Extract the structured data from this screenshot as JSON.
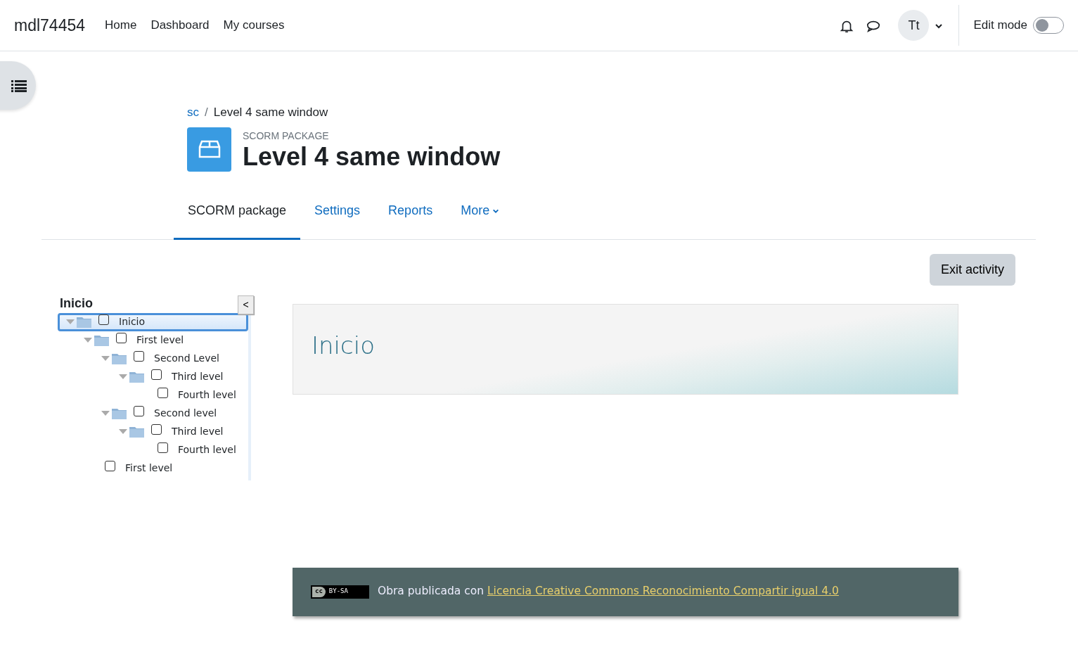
{
  "site_name": "mdl74454",
  "nav_links": [
    {
      "label": "Home"
    },
    {
      "label": "Dashboard"
    },
    {
      "label": "My courses"
    }
  ],
  "user_initials": "Tt",
  "edit_mode": {
    "label": "Edit mode",
    "on": false
  },
  "breadcrumb_separator": "/",
  "breadcrumb": [
    {
      "label": "sc",
      "kind": "link"
    },
    {
      "label": "Level 4 same window",
      "kind": "current"
    }
  ],
  "activity": {
    "type_label": "SCORM PACKAGE",
    "title": "Level 4 same window"
  },
  "tabs": [
    {
      "label": "SCORM package",
      "selected": true,
      "kind": "link"
    },
    {
      "label": "Settings",
      "selected": false,
      "kind": "link"
    },
    {
      "label": "Reports",
      "selected": false,
      "kind": "link"
    },
    {
      "label": "More",
      "selected": false,
      "kind": "dropdown"
    }
  ],
  "exit_button": "Exit activity",
  "toc": {
    "title": "Inicio",
    "collapse_button": "<",
    "items": [
      {
        "label": "Inicio",
        "selected": true,
        "checked": false,
        "expanded": true,
        "children": [
          {
            "label": "First level",
            "selected": false,
            "checked": false,
            "expanded": true,
            "children": [
              {
                "label": "Second Level",
                "selected": false,
                "checked": false,
                "expanded": true,
                "children": [
                  {
                    "label": "Third level",
                    "selected": false,
                    "checked": false,
                    "expanded": true,
                    "children": [
                      {
                        "label": "Fourth level",
                        "selected": false,
                        "checked": false
                      }
                    ]
                  }
                ]
              },
              {
                "label": "Second level",
                "selected": false,
                "checked": false,
                "expanded": true,
                "children": [
                  {
                    "label": "Third level",
                    "selected": false,
                    "checked": false,
                    "expanded": true,
                    "children": [
                      {
                        "label": "Fourth level",
                        "selected": false,
                        "checked": false
                      }
                    ]
                  }
                ]
              }
            ]
          },
          {
            "label": "First level",
            "selected": false,
            "checked": false
          }
        ]
      }
    ]
  },
  "content": {
    "heading": "Inicio"
  },
  "footer": {
    "cc_mark": "cc",
    "license_badge": "BY-SA",
    "text": "Obra publicada con",
    "link": "Licencia Creative Commons Reconocimiento Compartir igual 4.0"
  }
}
